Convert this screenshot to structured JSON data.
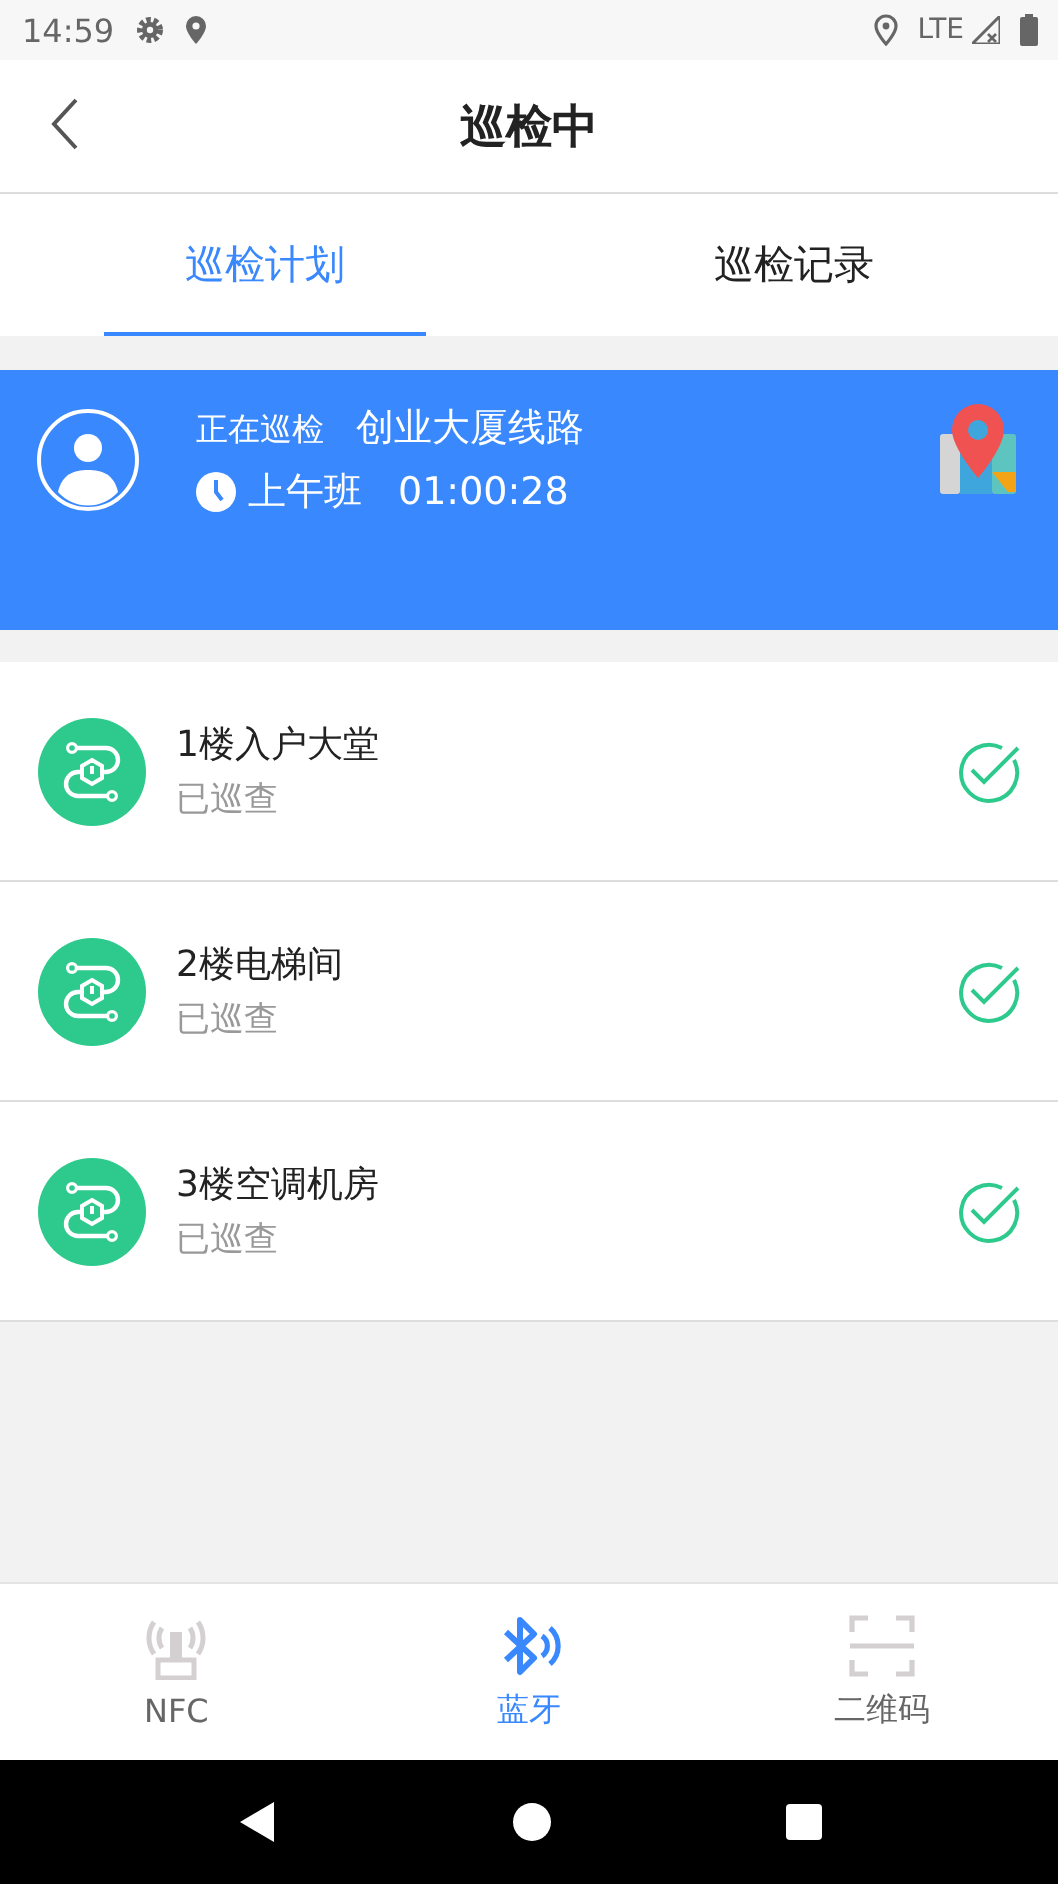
{
  "status_bar": {
    "time": "14:59",
    "network": "LTE"
  },
  "header": {
    "title": "巡检中"
  },
  "tabs": [
    {
      "label": "巡检计划",
      "selected": true
    },
    {
      "label": "巡检记录",
      "selected": false
    }
  ],
  "banner": {
    "status": "正在巡检",
    "route": "创业大厦线路",
    "shift": "上午班",
    "elapsed": "01:00:28"
  },
  "checkpoints": [
    {
      "name": "1楼入户大堂",
      "status": "已巡查",
      "checked": true
    },
    {
      "name": "2楼电梯间",
      "status": "已巡查",
      "checked": true
    },
    {
      "name": "3楼空调机房",
      "status": "已巡查",
      "checked": true
    }
  ],
  "bottom_nav": [
    {
      "label": "NFC",
      "kind": "nfc",
      "selected": false
    },
    {
      "label": "蓝牙",
      "kind": "bluetooth",
      "selected": true
    },
    {
      "label": "二维码",
      "kind": "qr",
      "selected": false
    }
  ]
}
